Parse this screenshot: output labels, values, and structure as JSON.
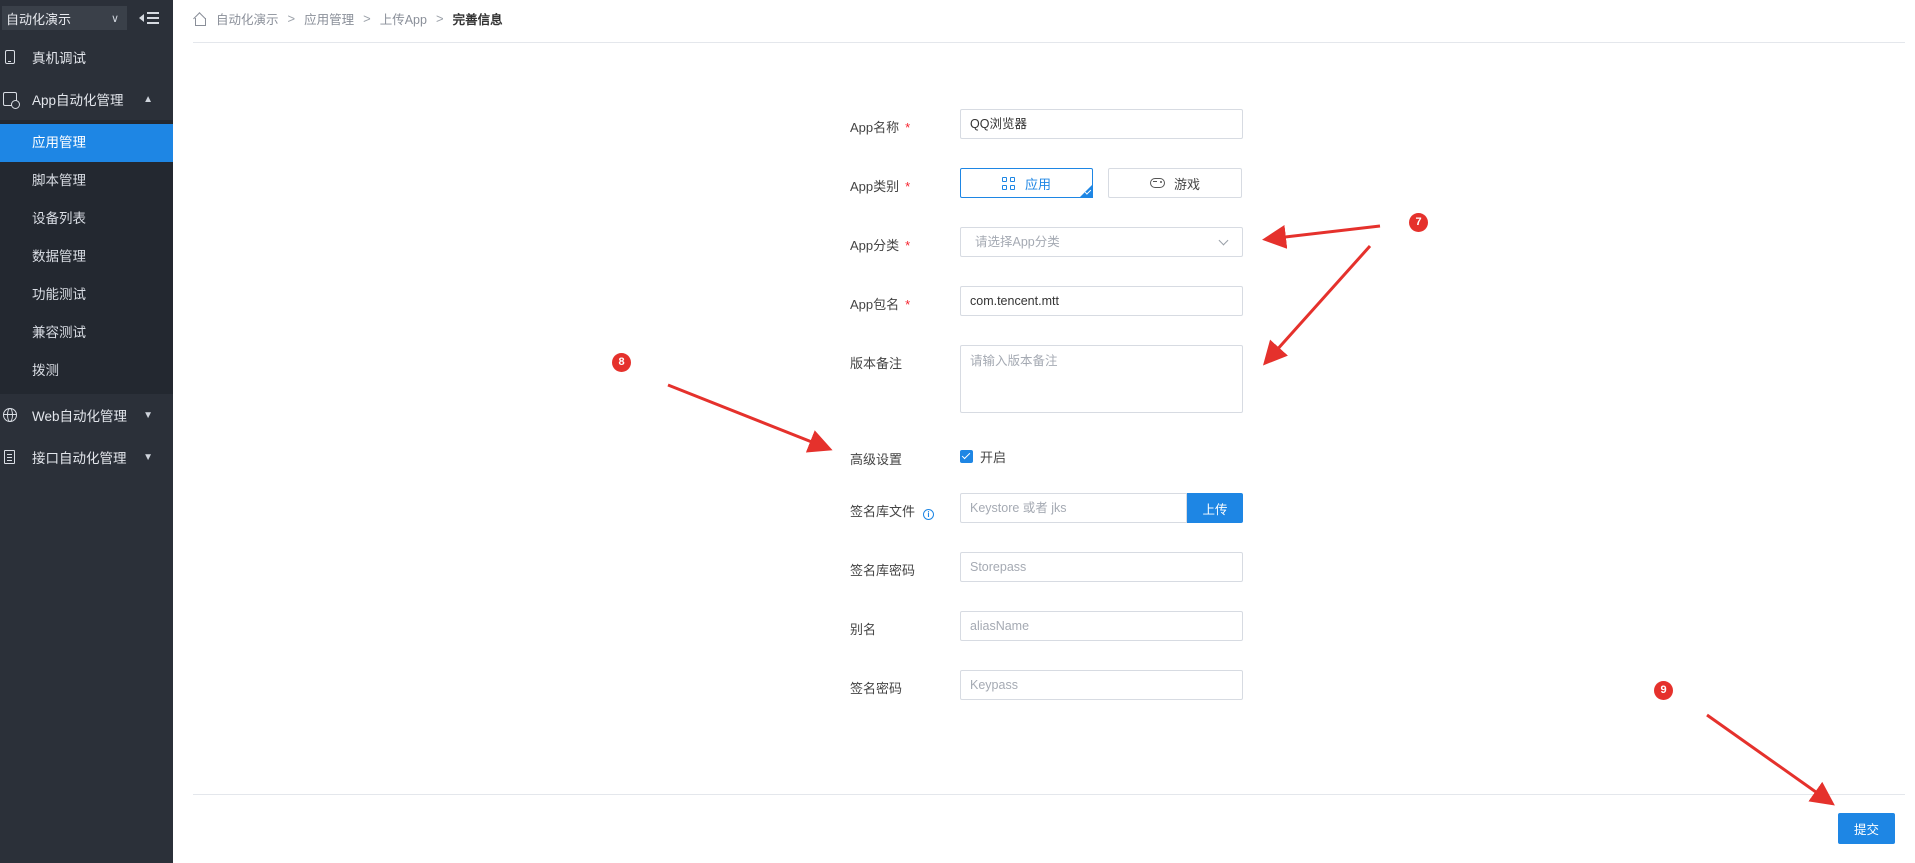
{
  "sidebar": {
    "project": "自动化演示",
    "menu": {
      "device_debug": "真机调试",
      "app_automation": "App自动化管理",
      "web_automation": "Web自动化管理",
      "api_automation": "接口自动化管理"
    },
    "submenu": [
      "应用管理",
      "脚本管理",
      "设备列表",
      "数据管理",
      "功能测试",
      "兼容测试",
      "拨测"
    ],
    "active_submenu": "应用管理"
  },
  "breadcrumb": [
    "自动化演示",
    "应用管理",
    "上传App",
    "完善信息"
  ],
  "form": {
    "app_name": {
      "label": "App名称",
      "value": "QQ浏览器"
    },
    "app_type": {
      "label": "App类别",
      "options": [
        "应用",
        "游戏"
      ],
      "selected": "应用"
    },
    "app_category": {
      "label": "App分类",
      "placeholder": "请选择App分类"
    },
    "package_name": {
      "label": "App包名",
      "value": "com.tencent.mtt"
    },
    "version_note": {
      "label": "版本备注",
      "placeholder": "请输入版本备注"
    },
    "advanced": {
      "label": "高级设置",
      "checkbox_label": "开启",
      "checked": true
    },
    "keystore": {
      "label": "签名库文件",
      "placeholder": "Keystore 或者 jks",
      "upload_label": "上传"
    },
    "storepass": {
      "label": "签名库密码",
      "placeholder": "Storepass"
    },
    "alias": {
      "label": "别名",
      "placeholder": "aliasName"
    },
    "keypass": {
      "label": "签名密码",
      "placeholder": "Keypass"
    },
    "required_mark": "*"
  },
  "submit_label": "提交",
  "annotations": [
    "7",
    "8",
    "9"
  ],
  "colors": {
    "accent": "#1e86e4",
    "sidebar_bg": "#2b3039",
    "annotation": "#e5312c"
  }
}
